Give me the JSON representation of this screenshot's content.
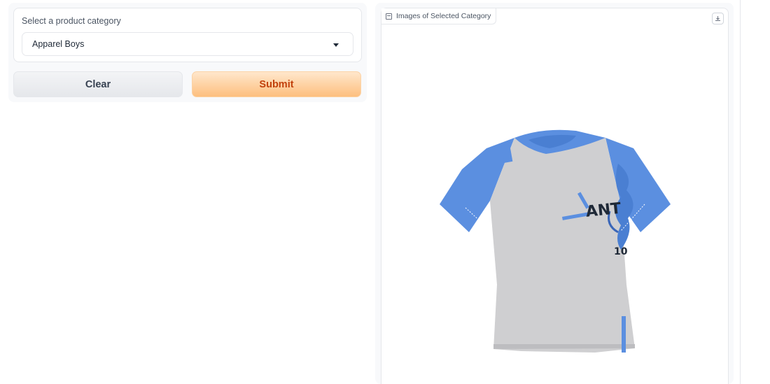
{
  "category_form": {
    "dropdown_label": "Select a product category",
    "selected_category": "Apparel Boys"
  },
  "actions": {
    "clear_label": "Clear",
    "submit_label": "Submit"
  },
  "gallery": {
    "label": "Images of Selected Category",
    "label_icon": "image-icon",
    "download_icon": "download-icon",
    "shirt_text": "ANT",
    "shirt_number": "10"
  },
  "colors": {
    "submit_text": "#c2410c",
    "submit_bg": "#fdbf7e",
    "sleeve_blue": "#5b8fe0",
    "body_gray": "#cfcfd1"
  }
}
